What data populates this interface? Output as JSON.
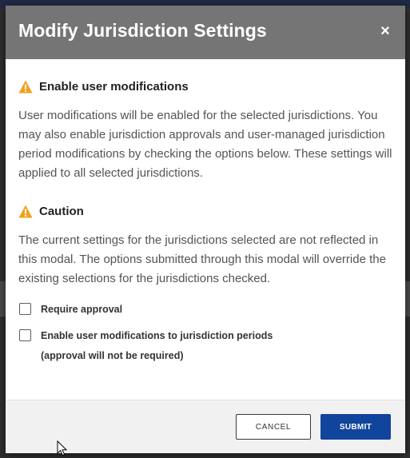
{
  "modal": {
    "title": "Modify Jurisdiction Settings",
    "close_glyph": "×",
    "close_icon": "close-icon"
  },
  "sections": {
    "enable": {
      "icon": "warning-icon",
      "heading": "Enable user modifications",
      "text": "User modifications will be enabled for the selected jurisdictions. You may also enable jurisdiction approvals and user-managed jurisdiction period modifications by checking the options below. These settings will applied to all selected jurisdictions."
    },
    "caution": {
      "icon": "warning-icon",
      "heading": "Caution",
      "text": "The current settings for the jurisdictions selected are not reflected in this modal. The options submitted through this modal will override the existing selections for the jurisdictions checked."
    }
  },
  "options": {
    "require_approval": {
      "label": "Require approval",
      "checked": false
    },
    "period_modifications": {
      "label": "Enable user modifications to jurisdiction periods",
      "sublabel": "(approval will not be required)",
      "checked": false
    }
  },
  "footer": {
    "cancel_label": "CANCEL",
    "submit_label": "SUBMIT"
  },
  "colors": {
    "header_bg": "#757575",
    "warning": "#f0a21c",
    "submit_bg": "#11449c",
    "footer_bg": "#f1f1f1"
  }
}
